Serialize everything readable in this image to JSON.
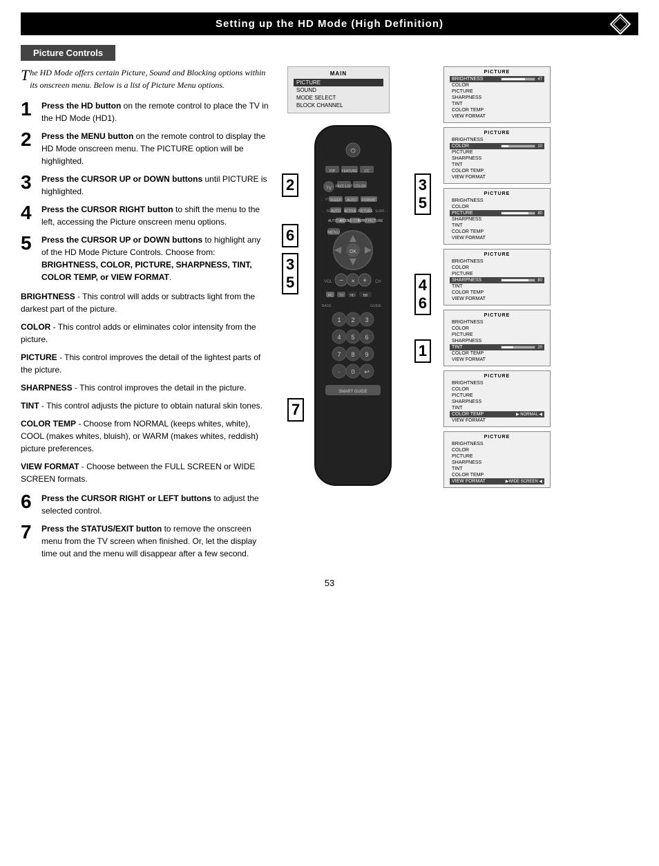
{
  "header": {
    "title": "Setting up the HD Mode (High Definition)"
  },
  "section": {
    "title": "Picture Controls"
  },
  "intro": {
    "text": "he HD Mode offers certain Picture, Sound and Blocking options within its onscreen menu. Below is a list of Picture Menu options."
  },
  "steps": [
    {
      "num": "1",
      "text": "Press the HD button on the remote control to place the TV in the HD Mode (HD1)."
    },
    {
      "num": "2",
      "text": "Press the MENU button on the remote control to display the HD Mode onscreen menu. The PICTURE option will be highlighted."
    },
    {
      "num": "3",
      "text": "Press the CURSOR UP or DOWN buttons until PICTURE is highlighted."
    },
    {
      "num": "4",
      "text": "Press the CURSOR RIGHT button to shift the menu to the left, accessing the Picture onscreen menu options."
    },
    {
      "num": "5",
      "text": "Press the CURSOR UP or DOWN buttons to highlight any of the HD Mode Picture Controls. Choose from: BRIGHTNESS, COLOR, PICTURE, SHARPNESS, TINT, COLOR TEMP, or VIEW FORMAT."
    }
  ],
  "descriptions": [
    {
      "label": "BRIGHTNESS",
      "text": " - This control will adds or subtracts light from the darkest part of the picture."
    },
    {
      "label": "COLOR",
      "text": " - This control adds or eliminates color intensity from the picture."
    },
    {
      "label": "PICTURE",
      "text": " - This control improves the detail of the lightest parts of the picture."
    },
    {
      "label": "SHARPNESS",
      "text": " - This control improves the detail in the picture."
    },
    {
      "label": "TINT",
      "text": " - This control adjusts the picture to obtain natural skin tones."
    },
    {
      "label": "COLOR TEMP",
      "text": " - Choose from NORMAL (keeps whites, white), COOL (makes whites, bluish), or WARM (makes whites, reddish) picture preferences."
    },
    {
      "label": "VIEW FORMAT",
      "text": " - Choose between the FULL SCREEN or WIDE SCREEN formats."
    }
  ],
  "bottom_steps": [
    {
      "num": "6",
      "text": "Press the CURSOR RIGHT or LEFT buttons to adjust the selected control."
    },
    {
      "num": "7",
      "text": "Press the STATUS/EXIT button to remove the onscreen menu from the TV screen when finished. Or, let the display time out and the menu will disappear after a few second."
    }
  ],
  "main_menu": {
    "title": "MAIN",
    "items": [
      "PICTURE",
      "SOUND",
      "MODE SELECT",
      "BLOCK CHANNEL"
    ],
    "selected": "PICTURE"
  },
  "picture_panels": [
    {
      "title": "PICTURE",
      "items": [
        "BRIGHTNESS",
        "COLOR",
        "PICTURE",
        "SHARPNESS",
        "TINT",
        "COLOR TEMP",
        "VIEW FORMAT"
      ],
      "active": "BRIGHTNESS",
      "bar_item": "BRIGHTNESS",
      "bar_value": 47,
      "bar_pct": 70
    },
    {
      "title": "PICTURE",
      "items": [
        "BRIGHTNESS",
        "COLOR",
        "PICTURE",
        "SHARPNESS",
        "TINT",
        "COLOR TEMP",
        "VIEW FORMAT"
      ],
      "active": "COLOR",
      "bar_item": "COLOR",
      "bar_value": 10,
      "bar_pct": 20
    },
    {
      "title": "PICTURE",
      "items": [
        "BRIGHTNESS",
        "COLOR",
        "PICTURE",
        "SHARPNESS",
        "TINT",
        "COLOR TEMP",
        "VIEW FORMAT"
      ],
      "active": "PICTURE",
      "bar_item": "PICTURE",
      "bar_value": 80,
      "bar_pct": 80
    },
    {
      "title": "PICTURE",
      "items": [
        "BRIGHTNESS",
        "COLOR",
        "PICTURE",
        "SHARPNESS",
        "TINT",
        "COLOR TEMP",
        "VIEW FORMAT"
      ],
      "active": "SHARPNESS",
      "bar_item": "SHARPNESS",
      "bar_value": 80,
      "bar_pct": 80
    },
    {
      "title": "PICTURE",
      "items": [
        "BRIGHTNESS",
        "COLOR",
        "PICTURE",
        "SHARPNESS",
        "TINT",
        "COLOR TEMP",
        "VIEW FORMAT"
      ],
      "active": "TINT",
      "bar_item": "TINT",
      "bar_value": 20,
      "bar_pct": 35
    },
    {
      "title": "PICTURE",
      "items": [
        "BRIGHTNESS",
        "COLOR",
        "PICTURE",
        "SHARPNESS",
        "TINT",
        "COLOR TEMP",
        "VIEW FORMAT"
      ],
      "active": "COLOR TEMP",
      "bar_item": "COLOR TEMP",
      "bar_value": null,
      "bar_text": "NORMAL",
      "bar_pct": null
    },
    {
      "title": "PICTURE",
      "items": [
        "BRIGHTNESS",
        "COLOR",
        "PICTURE",
        "SHARPNESS",
        "TINT",
        "COLOR TEMP",
        "VIEW FORMAT"
      ],
      "active": "VIEW FORMAT",
      "bar_item": "VIEW FORMAT",
      "bar_value": null,
      "bar_text": "WIDE SCREEN",
      "bar_pct": null
    }
  ],
  "page_number": "53"
}
